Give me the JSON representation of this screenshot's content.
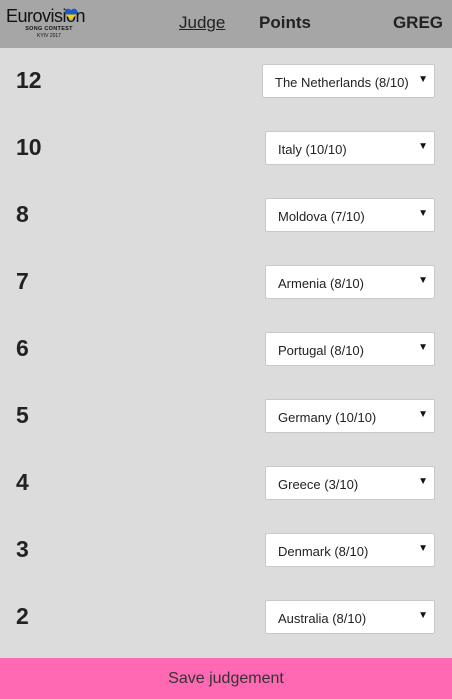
{
  "header": {
    "logo_word": "Eurovision",
    "logo_sub": "SONG CONTEST",
    "logo_sub2": "KYIV 2017",
    "nav_judge": "Judge",
    "nav_points": "Points",
    "user": "GREG"
  },
  "rows": [
    {
      "points": "12",
      "choice": "The Netherlands (8/10)"
    },
    {
      "points": "10",
      "choice": "Italy (10/10)"
    },
    {
      "points": "8",
      "choice": "Moldova (7/10)"
    },
    {
      "points": "7",
      "choice": "Armenia (8/10)"
    },
    {
      "points": "6",
      "choice": "Portugal (8/10)"
    },
    {
      "points": "5",
      "choice": "Germany (10/10)"
    },
    {
      "points": "4",
      "choice": "Greece (3/10)"
    },
    {
      "points": "3",
      "choice": "Denmark (8/10)"
    },
    {
      "points": "2",
      "choice": "Australia (8/10)"
    }
  ],
  "save_label": "Save judgement",
  "colors": {
    "header_bg": "#a6a6a6",
    "page_bg": "#dcdcdc",
    "save_bg": "#ff69b4",
    "heart_blue": "#1e5bc6",
    "heart_yellow": "#f5d10a"
  },
  "icons": {
    "dropdown": "chevron-down-icon",
    "logo_heart": "heart-flag-icon"
  }
}
